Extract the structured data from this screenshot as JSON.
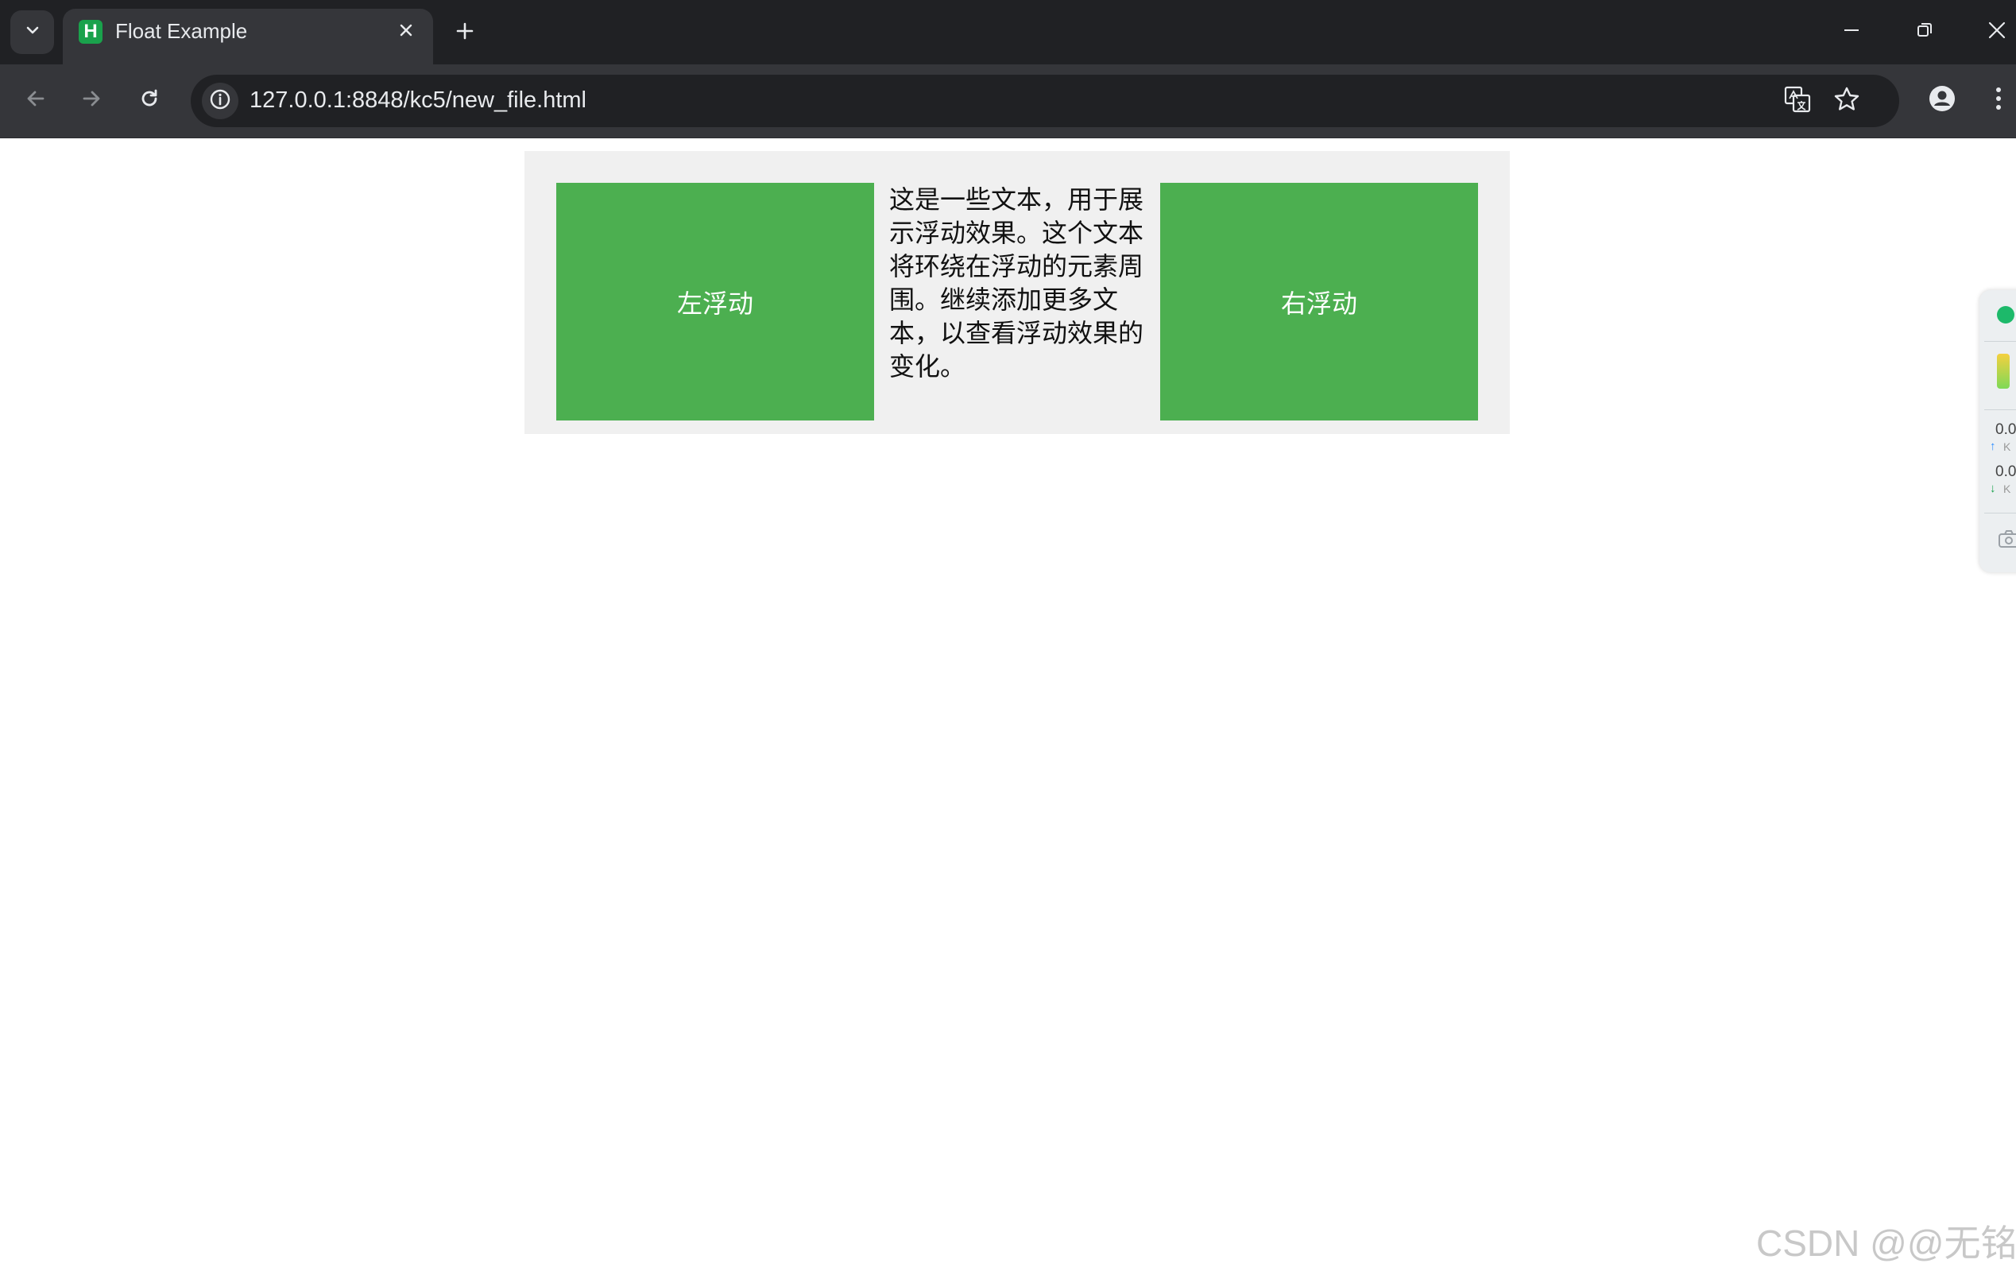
{
  "browser": {
    "tab": {
      "title": "Float Example",
      "favicon_letter": "H"
    },
    "address_bar": {
      "url": "127.0.0.1:8848/kc5/new_file.html"
    },
    "icons": {
      "tab_search": "chevron-down-icon",
      "close_tab": "close-icon",
      "new_tab": "plus-icon",
      "minimize": "minimize-icon",
      "restore": "restore-icon",
      "close_window": "close-icon",
      "back": "arrow-left-icon",
      "forward": "arrow-right-icon",
      "reload": "reload-icon",
      "site_info": "info-icon",
      "translate": "translate-icon",
      "bookmark": "star-icon",
      "profile": "person-icon",
      "menu": "more-vertical-icon"
    }
  },
  "page": {
    "left_box": "左浮动",
    "right_box": "右浮动",
    "paragraph": "这是一些文本，用于展示浮动效果。这个文本将环绕在浮动的元素周围。继续添加更多文本，以查看浮动效果的变化。",
    "colors": {
      "box": "#4caf50",
      "container": "#f0f0f0"
    }
  },
  "side_widget": {
    "upload": "0.0",
    "upload_unit": "K",
    "download": "0.0",
    "download_unit": "K"
  },
  "watermark": "CSDN @@无铭"
}
